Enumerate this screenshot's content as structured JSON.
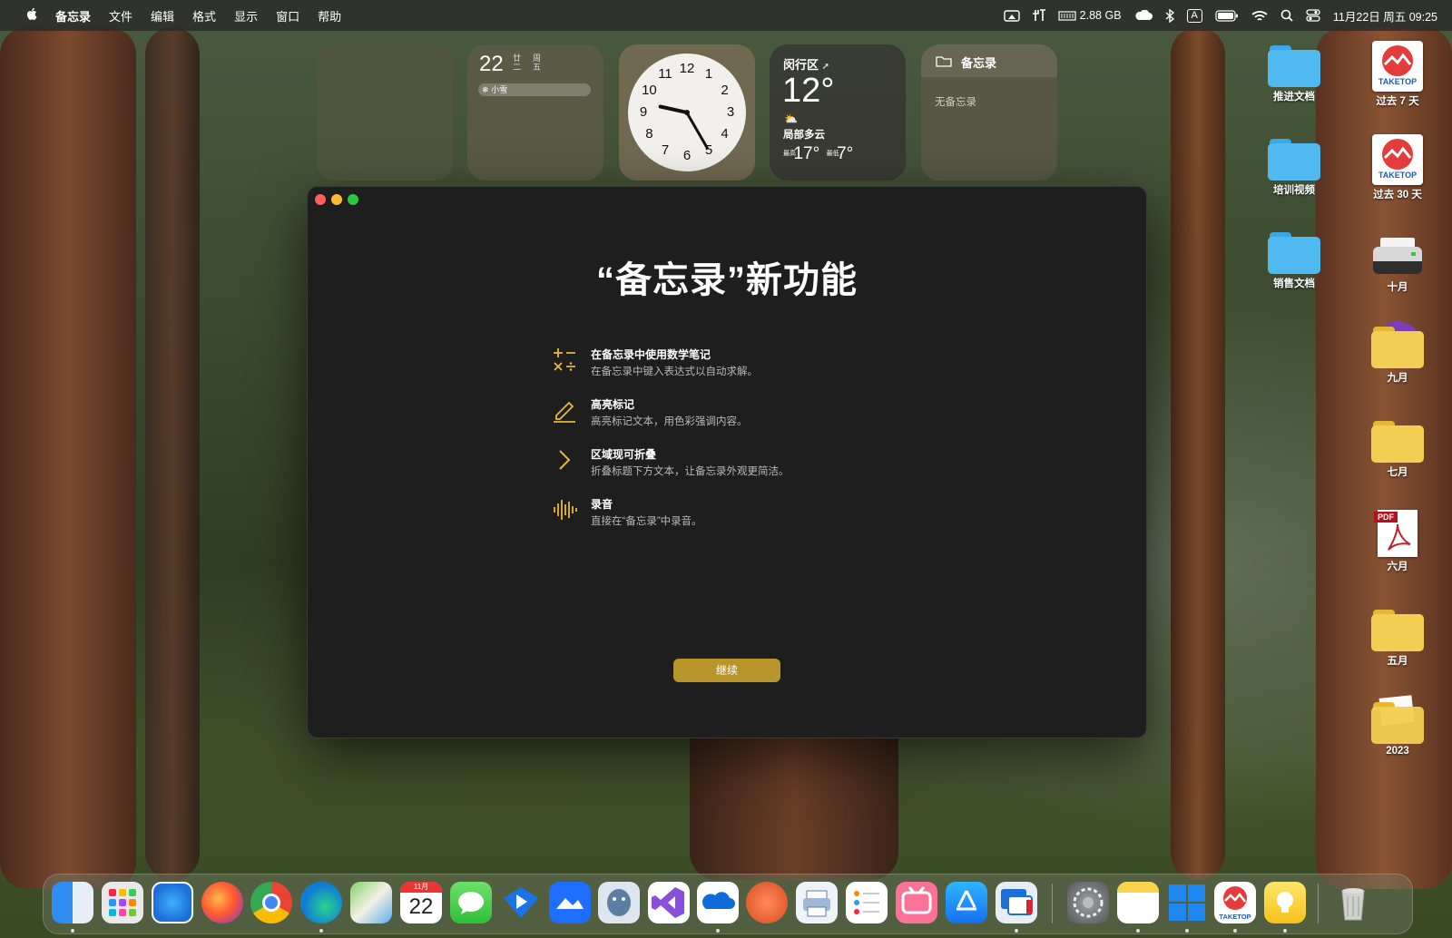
{
  "menubar": {
    "app_name": "备忘录",
    "menus": [
      "文件",
      "编辑",
      "格式",
      "显示",
      "窗口",
      "帮助"
    ],
    "memory": "2.88 GB",
    "input_method": "A",
    "datetime": "11月22日 周五 09:25"
  },
  "widgets": {
    "calendar": {
      "day": "22",
      "lunar": "廿二",
      "weekday": "周五",
      "event": "小雪"
    },
    "clock": {
      "hour": 9,
      "minute": 25,
      "numbers": [
        "12",
        "1",
        "2",
        "3",
        "4",
        "5",
        "6",
        "7",
        "8",
        "9",
        "10",
        "11"
      ]
    },
    "weather": {
      "location": "闵行区",
      "temp": "12°",
      "condition": "局部多云",
      "high_label": "最高",
      "high": "17°",
      "low_label": "最低",
      "low": "7°"
    },
    "notes": {
      "title": "备忘录",
      "empty": "无备忘录"
    }
  },
  "dialog": {
    "title": "“备忘录”新功能",
    "features": [
      {
        "title": "在备忘录中使用数学笔记",
        "desc": "在备忘录中键入表达式以自动求解。",
        "icon": "math-icon"
      },
      {
        "title": "高亮标记",
        "desc": "高亮标记文本，用色彩强调内容。",
        "icon": "pencil-icon"
      },
      {
        "title": "区域现可折叠",
        "desc": "折叠标题下方文本，让备忘录外观更简洁。",
        "icon": "chevron-right-icon"
      },
      {
        "title": "录音",
        "desc": "直接在“备忘录”中录音。",
        "icon": "waveform-icon"
      }
    ],
    "continue_label": "继续"
  },
  "desktop": {
    "left_column": [
      "推进文档",
      "培训视频",
      "销售文档"
    ],
    "right_column": [
      "过去 7 天",
      "过去 30 天",
      "十月",
      "九月",
      "七月",
      "六月",
      "五月",
      "2023"
    ],
    "pdf_label": "PDF",
    "taketop_text": "TAKETOP"
  },
  "dock": {
    "calendar_month": "11月",
    "calendar_day": "22",
    "apps": [
      "finder",
      "launchpad",
      "safari",
      "firefox",
      "chrome",
      "edge",
      "maps",
      "calendar",
      "messages",
      "tencent-meeting",
      "lark",
      "tableplus",
      "visual-studio",
      "onedrive",
      "powerpoint-remote",
      "printer",
      "reminders",
      "bilibili",
      "app-store",
      "remote-desktop",
      "system-settings",
      "notes",
      "windows-app",
      "taketop",
      "tips",
      "trash"
    ]
  },
  "colors": {
    "accent": "#e8b83a",
    "button": "#b8952b",
    "dialog_bg": "#1e1e1e"
  }
}
